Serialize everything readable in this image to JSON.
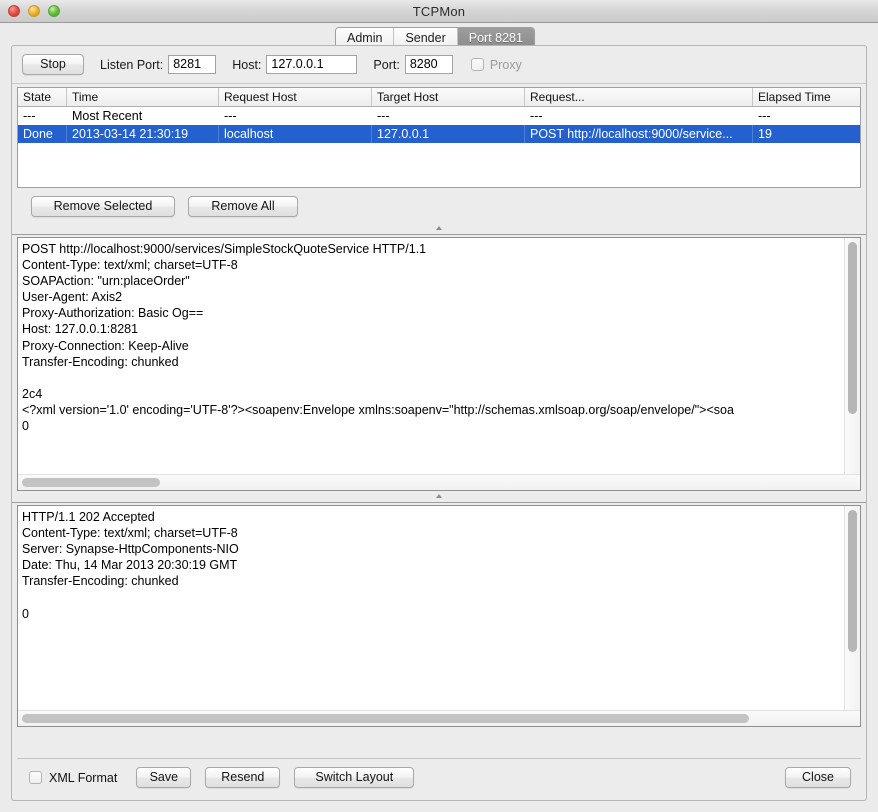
{
  "window": {
    "title": "TCPMon",
    "controls": [
      "close",
      "minimize",
      "zoom"
    ]
  },
  "tabs": [
    {
      "label": "Admin",
      "active": false
    },
    {
      "label": "Sender",
      "active": false
    },
    {
      "label": "Port 8281",
      "active": true
    }
  ],
  "connection_bar": {
    "stop_button": "Stop",
    "listen_port_label": "Listen Port:",
    "listen_port_value": "8281",
    "host_label": "Host:",
    "host_value": "127.0.0.1",
    "port_label": "Port:",
    "port_value": "8280",
    "proxy_label": "Proxy",
    "proxy_checked": false
  },
  "table": {
    "columns": [
      "State",
      "Time",
      "Request Host",
      "Target Host",
      "Request...",
      "Elapsed Time"
    ],
    "rows": [
      {
        "selected": false,
        "cells": [
          "---",
          "Most Recent",
          "---",
          "---",
          "---",
          "---"
        ]
      },
      {
        "selected": true,
        "cells": [
          "Done",
          "2013-03-14 21:30:19",
          "localhost",
          "127.0.0.1",
          "POST http://localhost:9000/service...",
          "19"
        ]
      }
    ]
  },
  "remove_bar": {
    "remove_selected": "Remove Selected",
    "remove_all": "Remove All"
  },
  "request_pane": {
    "text": "POST http://localhost:9000/services/SimpleStockQuoteService HTTP/1.1\nContent-Type: text/xml; charset=UTF-8\nSOAPAction: \"urn:placeOrder\"\nUser-Agent: Axis2\nProxy-Authorization: Basic Og==\nHost: 127.0.0.1:8281\nProxy-Connection: Keep-Alive\nTransfer-Encoding: chunked\n\n2c4\n<?xml version='1.0' encoding='UTF-8'?><soapenv:Envelope xmlns:soapenv=\"http://schemas.xmlsoap.org/soap/envelope/\"><soa\n0"
  },
  "response_pane": {
    "text": "HTTP/1.1 202 Accepted\nContent-Type: text/xml; charset=UTF-8\nServer: Synapse-HttpComponents-NIO\nDate: Thu, 14 Mar 2013 20:30:19 GMT\nTransfer-Encoding: chunked\n\n0"
  },
  "bottom_bar": {
    "xml_format_label": "XML Format",
    "xml_format_checked": false,
    "save": "Save",
    "resend": "Resend",
    "switch_layout": "Switch Layout",
    "close": "Close"
  },
  "colors": {
    "selection_blue": "#2461cf",
    "window_bg": "#ebebeb",
    "active_tab_gray": "#949494"
  }
}
